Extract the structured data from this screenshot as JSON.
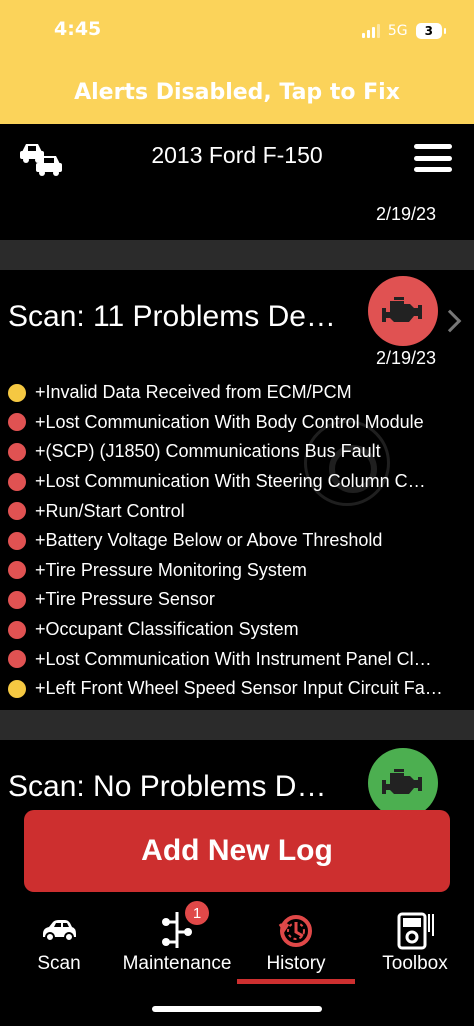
{
  "status": {
    "time": "4:45",
    "network": "5G",
    "battery": "3"
  },
  "alert": {
    "text": "Alerts Disabled, Tap to Fix"
  },
  "nav": {
    "title": "2013 Ford F-150",
    "left_icon": "cars-icon",
    "right_icon": "menu-icon"
  },
  "history": {
    "cards": [
      {
        "date": "2/19/23",
        "status_color": "#e8b437"
      },
      {
        "title": "Scan: 11 Problems De…",
        "date": "2/19/23",
        "status_color": "#e05252",
        "problems": [
          {
            "text": "+Invalid Data Received from ECM/PCM",
            "severity": "yellow"
          },
          {
            "text": "+Lost Communication With Body Control Module",
            "severity": "red"
          },
          {
            "text": "+(SCP) (J1850) Communications Bus Fault",
            "severity": "red"
          },
          {
            "text": "+Lost Communication With Steering Column C…",
            "severity": "red"
          },
          {
            "text": "+Run/Start Control",
            "severity": "red"
          },
          {
            "text": "+Battery Voltage Below or Above Threshold",
            "severity": "red"
          },
          {
            "text": "+Tire Pressure Monitoring System",
            "severity": "red"
          },
          {
            "text": "+Tire Pressure Sensor",
            "severity": "red"
          },
          {
            "text": "+Occupant Classification System",
            "severity": "red"
          },
          {
            "text": "+Lost Communication With Instrument Panel Cl…",
            "severity": "red"
          },
          {
            "text": "+Left Front Wheel Speed Sensor Input Circuit Fa…",
            "severity": "yellow"
          }
        ]
      },
      {
        "title": "Scan: No Problems D…",
        "status_color": "#4caf50"
      }
    ]
  },
  "actions": {
    "add_log": "Add New Log"
  },
  "tabs": [
    {
      "label": "Scan",
      "icon": "car-icon",
      "selected": false
    },
    {
      "label": "Maintenance",
      "icon": "maintenance-icon",
      "badge": "1",
      "selected": false
    },
    {
      "label": "History",
      "icon": "history-icon",
      "selected": true
    },
    {
      "label": "Toolbox",
      "icon": "multimeter-icon",
      "selected": false
    }
  ],
  "colors": {
    "brand_yellow": "#fbd35a",
    "danger_red": "#cd2f2f",
    "dot_red": "#e05252",
    "dot_yellow": "#f5c842",
    "ok_green": "#4caf50",
    "separator": "#2b2b2b"
  }
}
